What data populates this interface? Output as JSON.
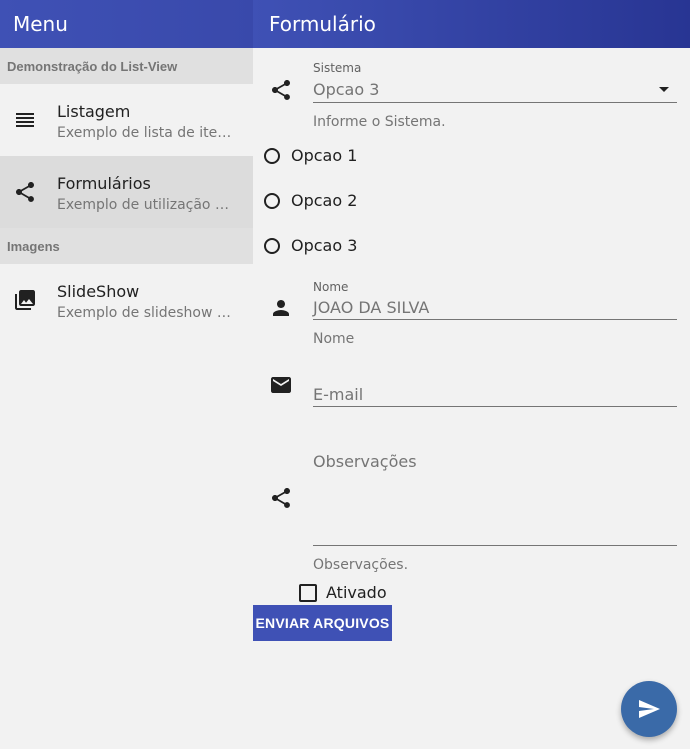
{
  "sidebar": {
    "title": "Menu",
    "sections": [
      {
        "header": "Demonstração do List-View"
      },
      {
        "header": "Imagens"
      }
    ],
    "items": [
      {
        "title": "Listagem",
        "subtitle": "Exemplo de lista de items.",
        "icon": "list-icon"
      },
      {
        "title": "Formulários",
        "subtitle": "Exemplo de utilização de f…",
        "icon": "share-icon",
        "selected": true
      },
      {
        "title": "SlideShow",
        "subtitle": "Exemplo de slideshow de i…",
        "icon": "photo-library-icon"
      }
    ]
  },
  "main": {
    "title": "Formulário",
    "sistema": {
      "label": "Sistema",
      "value": "Opcao 3",
      "hint": "Informe o Sistema.",
      "icon": "share-icon"
    },
    "radios": [
      {
        "label": "Opcao 1"
      },
      {
        "label": "Opcao 2"
      },
      {
        "label": "Opcao 3"
      }
    ],
    "nome": {
      "label": "Nome",
      "value": "JOAO DA SILVA",
      "hint": "Nome",
      "icon": "person-icon"
    },
    "email": {
      "placeholder": "E-mail",
      "icon": "mail-icon"
    },
    "observacoes": {
      "placeholder": "Observações",
      "hint": "Observações.",
      "icon": "share-icon"
    },
    "ativado": {
      "label": "Ativado",
      "checked": false
    },
    "upload_button": "ENVIAR ARQUIVOS",
    "fab_icon": "send-icon"
  },
  "colors": {
    "primary": "#3f51b5",
    "fab": "#3a6aa8",
    "background": "#f2f2f2"
  }
}
